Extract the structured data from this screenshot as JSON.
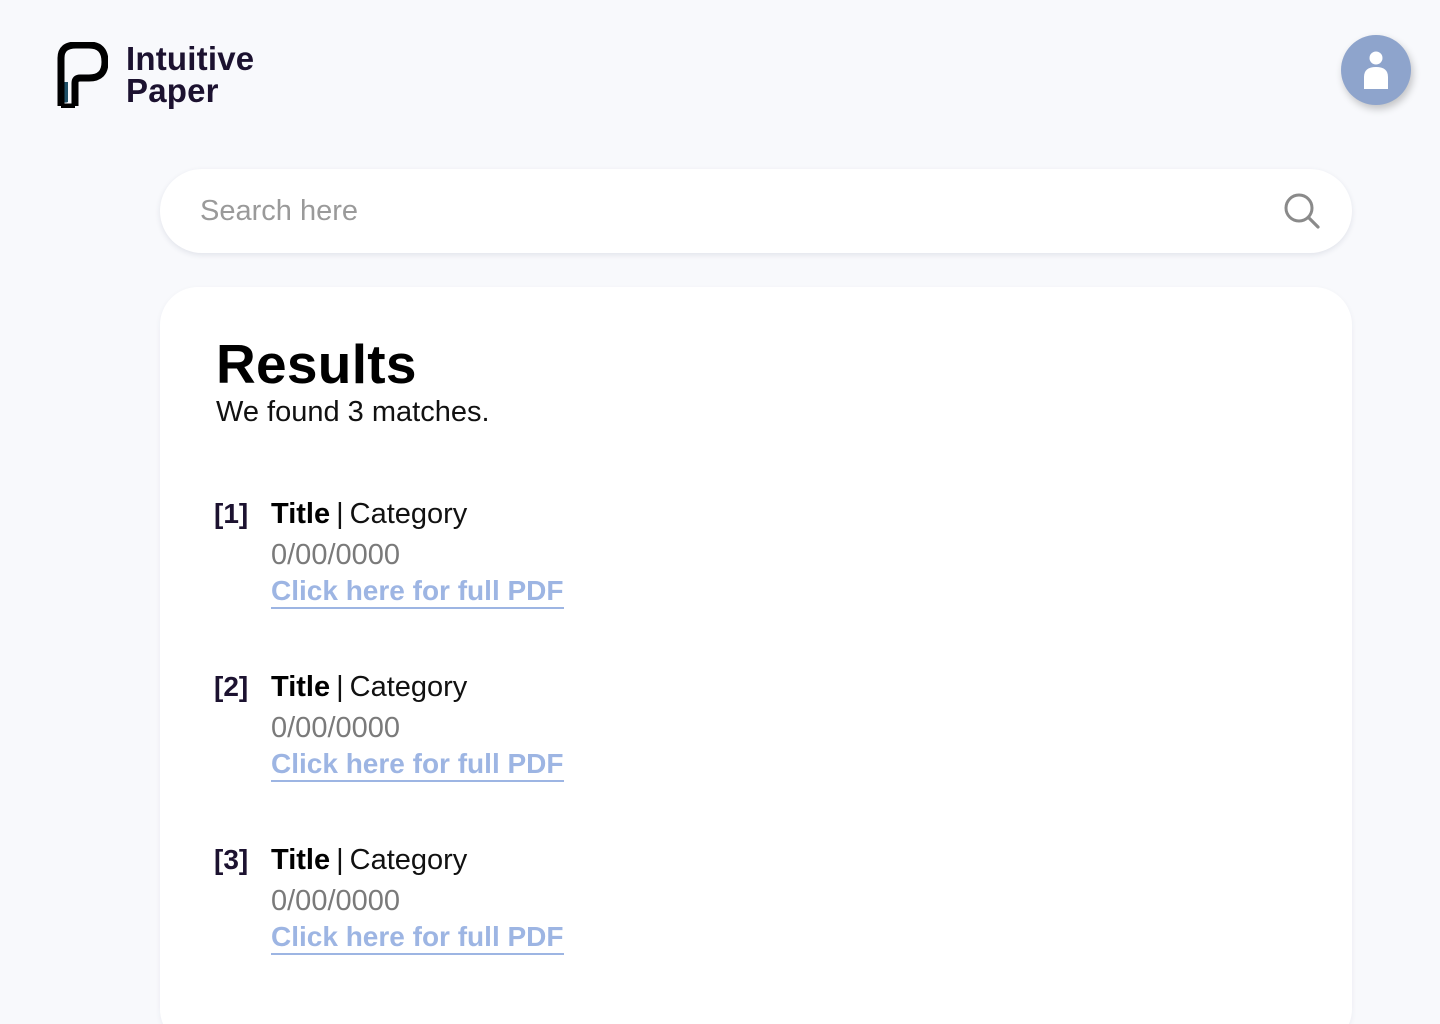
{
  "brand": {
    "logo_icon": "paper-logo-icon",
    "name_line1": "Intuitive",
    "name_line2": "Paper"
  },
  "user": {
    "avatar_icon": "user-icon"
  },
  "search": {
    "placeholder": "Search here",
    "value": "",
    "icon": "search-icon"
  },
  "results": {
    "title": "Results",
    "summary": "We found 3 matches.",
    "items": [
      {
        "index": "[1]",
        "title": "Title",
        "separator": "|",
        "category": "Category",
        "date": "0/00/0000",
        "link_label": "Click here for full PDF"
      },
      {
        "index": "[2]",
        "title": "Title",
        "separator": "|",
        "category": "Category",
        "date": "0/00/0000",
        "link_label": "Click here for full PDF"
      },
      {
        "index": "[3]",
        "title": "Title",
        "separator": "|",
        "category": "Category",
        "date": "0/00/0000",
        "link_label": "Click here for full PDF"
      }
    ]
  },
  "colors": {
    "background": "#f8f9fc",
    "brand_text": "#1c1230",
    "avatar": "#8ea4cc",
    "link": "#9db5e3",
    "muted_text": "#7a7a7a",
    "logo_accent": "#1f4f66"
  }
}
